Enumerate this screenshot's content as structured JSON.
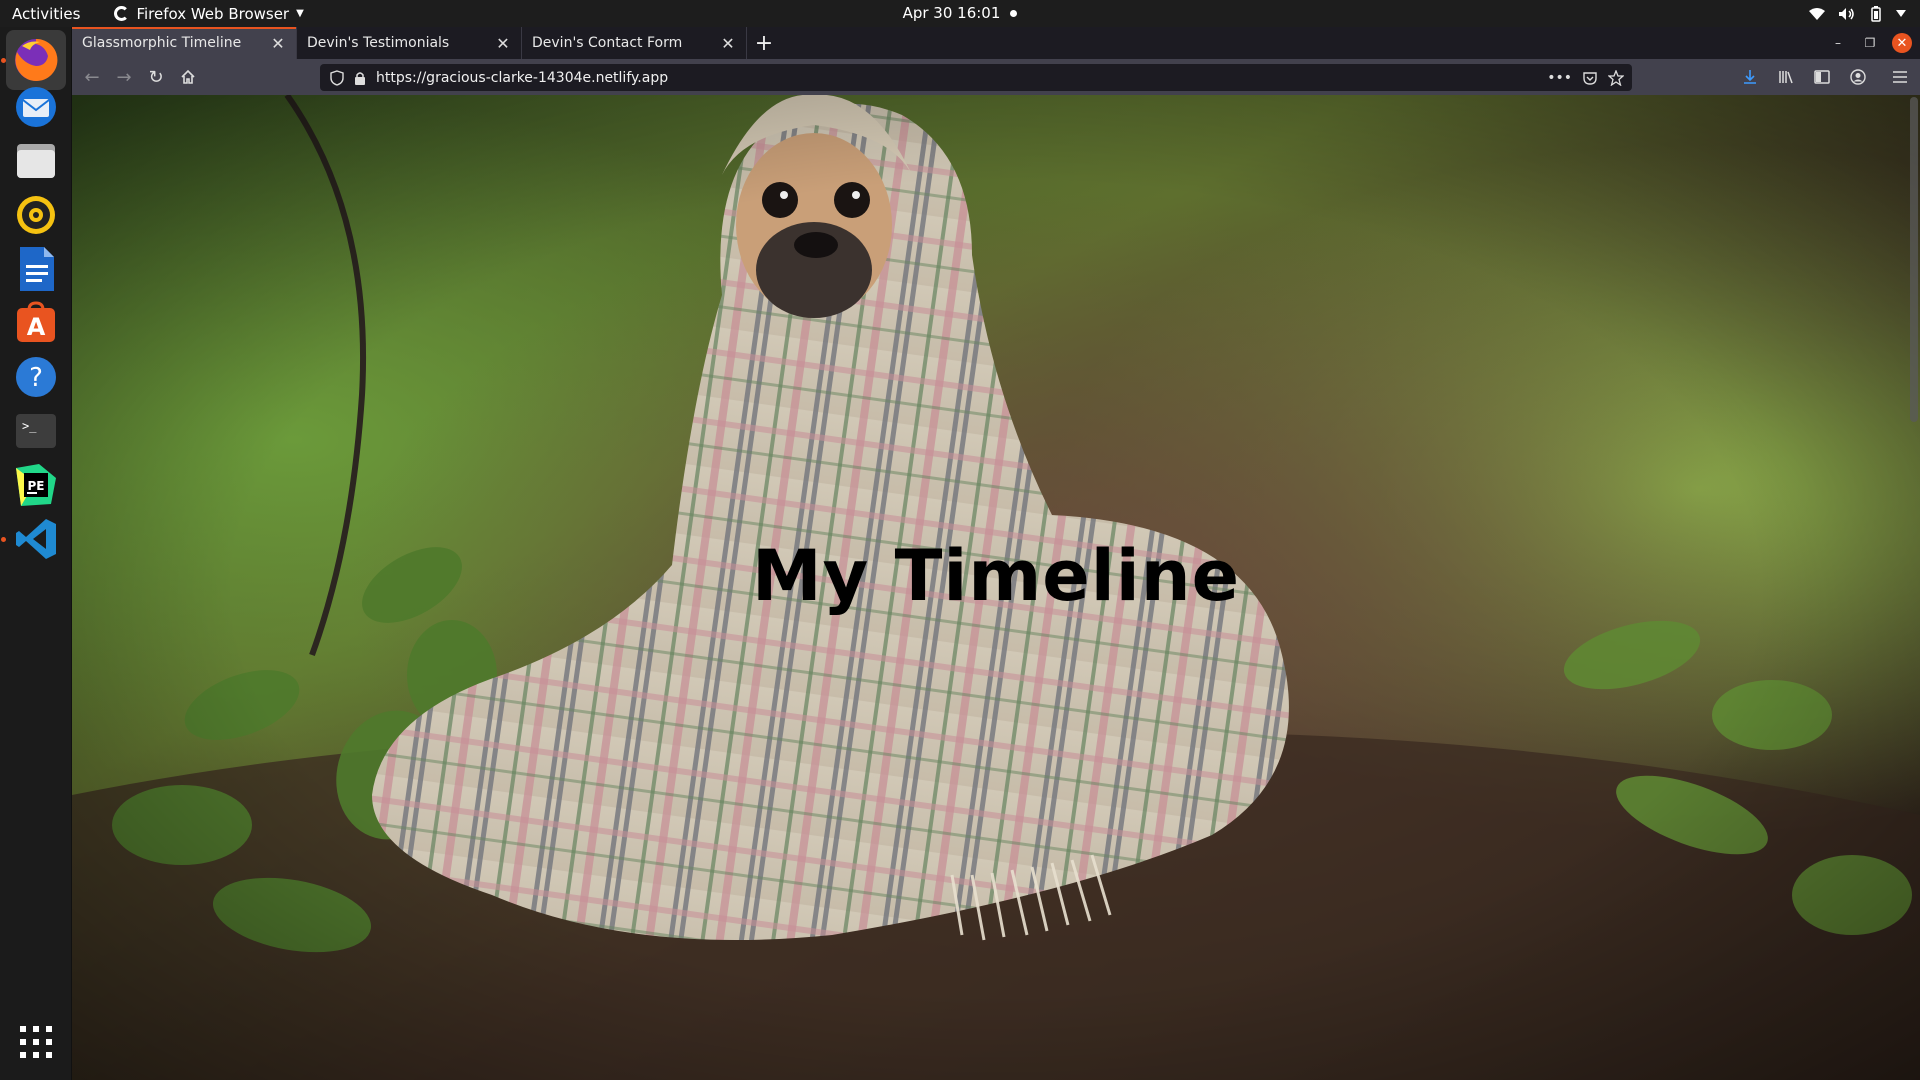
{
  "topbar": {
    "activities": "Activities",
    "app_name": "Firefox Web Browser",
    "datetime": "Apr 30  16:01"
  },
  "dock": {
    "items": [
      "firefox",
      "thunderbird",
      "files",
      "rhythmbox",
      "libreoffice-writer",
      "ubuntu-software",
      "help",
      "terminal",
      "pycharm-edu",
      "vscode",
      "show-applications"
    ]
  },
  "browser": {
    "tabs": [
      {
        "title": "Glassmorphic Timeline",
        "active": true
      },
      {
        "title": "Devin's Testimonials",
        "active": false
      },
      {
        "title": "Devin's Contact Form",
        "active": false
      }
    ],
    "url": "https://gracious-clarke-14304e.netlify.app"
  },
  "page": {
    "title": "My Timeline"
  },
  "colors": {
    "accent": "#e95420",
    "topbar_bg": "#1d1d1d",
    "tab_active_bg": "#42414d",
    "url_bg": "#1c1b22"
  }
}
